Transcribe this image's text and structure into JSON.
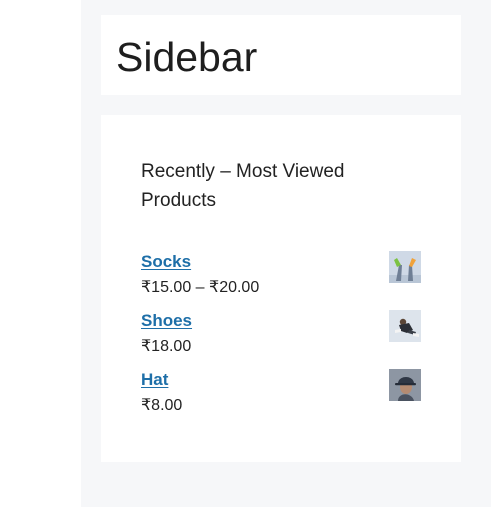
{
  "sidebar": {
    "title": "Sidebar",
    "widget": {
      "title": "Recently – Most Viewed Products",
      "products": [
        {
          "name": "Socks",
          "price": "₹15.00 – ₹20.00",
          "thumbnail_icon": "socks-photo"
        },
        {
          "name": "Shoes",
          "price": "₹18.00",
          "thumbnail_icon": "shoes-photo"
        },
        {
          "name": "Hat",
          "price": "₹8.00",
          "thumbnail_icon": "hat-photo"
        }
      ]
    }
  },
  "colors": {
    "link": "#1e6fa8",
    "sidebar_background": "#f6f7f9",
    "card_background": "#ffffff",
    "text": "#222222"
  }
}
